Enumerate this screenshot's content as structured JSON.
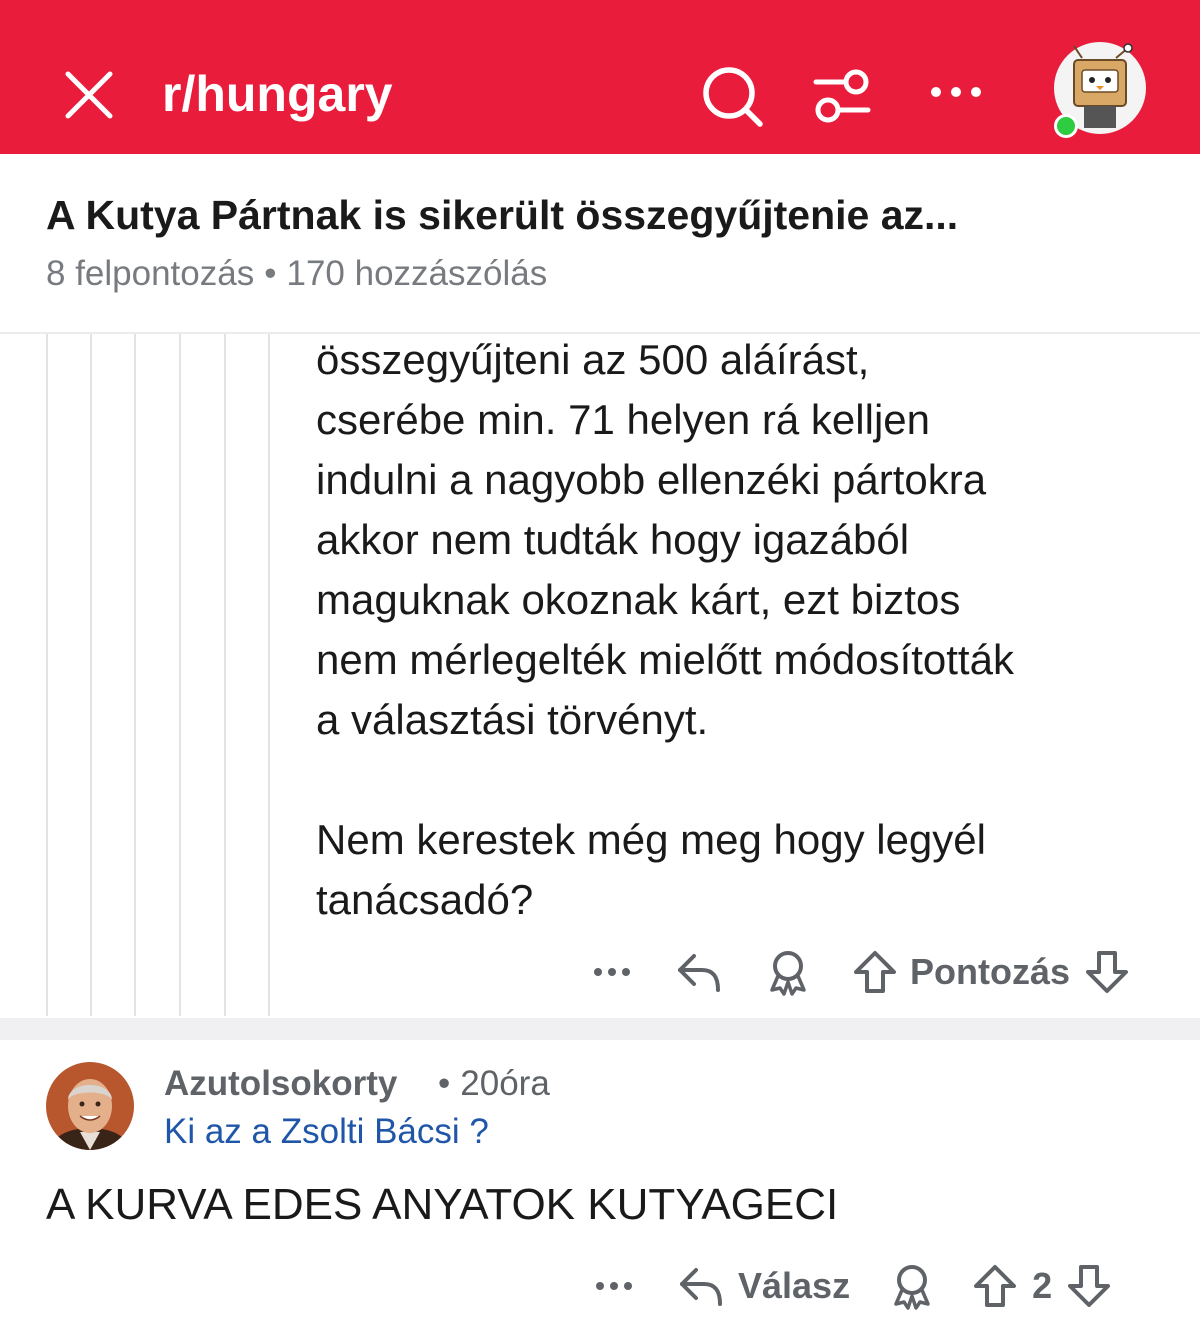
{
  "header": {
    "subreddit": "r/hungary",
    "icons": {
      "close": "close-icon",
      "search": "search-icon",
      "filter": "filter-icon",
      "more": "more-dots-icon"
    },
    "accent_color": "#e91c3c"
  },
  "post": {
    "title": "A Kutya Pártnak is sikerült összegyűjtenie az...",
    "upvotes": "8 felpontozás",
    "comments": "170 hozzászólás",
    "meta_separator": "•"
  },
  "comment1": {
    "lines": [
      "összegyűjteni az 500 aláírást,",
      "cserébe min. 71 helyen rá kelljen",
      "indulni a nagyobb ellenzéki pártokra",
      "akkor nem tudták hogy igazából",
      "maguknak okoznak kárt, ezt biztos",
      "nem mérlegelték mielőtt módosították",
      "a választási törvényt."
    ],
    "lines2": [
      "Nem kerestek még meg hogy legyél",
      "tanácsadó?"
    ],
    "vote_label": "Pontozás"
  },
  "comment2": {
    "author": "Azutolsokorty",
    "time": "20óra",
    "flair": "Ki az a Zsolti Bácsi ?",
    "body": "A KURVA EDES ANYATOK KUTYAGECI",
    "reply_label": "Válasz",
    "score": "2"
  }
}
